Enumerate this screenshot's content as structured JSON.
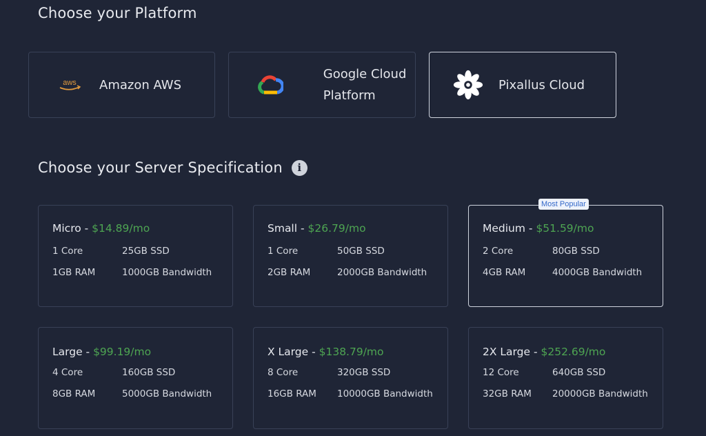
{
  "platform_section": {
    "title": "Choose your Platform",
    "options": [
      {
        "label": "Amazon AWS",
        "logo_text": "aws",
        "selected": false
      },
      {
        "label": "Google Cloud Platform",
        "selected": false
      },
      {
        "label": "Pixallus Cloud",
        "selected": true
      }
    ]
  },
  "spec_section": {
    "title": "Choose your Server Specification",
    "info_icon": "i",
    "badge": "Most Popular",
    "plans": [
      {
        "name": "Micro",
        "sep": " - ",
        "price": "$14.89/mo",
        "cores": "1 Core",
        "ssd": "25GB SSD",
        "ram": "1GB RAM",
        "bandwidth": "1000GB Bandwidth",
        "selected": false
      },
      {
        "name": "Small",
        "sep": " - ",
        "price": "$26.79/mo",
        "cores": "1 Core",
        "ssd": "50GB SSD",
        "ram": "2GB RAM",
        "bandwidth": "2000GB Bandwidth",
        "selected": false
      },
      {
        "name": "Medium",
        "sep": " - ",
        "price": "$51.59/mo",
        "cores": "2 Core",
        "ssd": "80GB SSD",
        "ram": "4GB RAM",
        "bandwidth": "4000GB Bandwidth",
        "selected": true
      },
      {
        "name": "Large",
        "sep": " - ",
        "price": "$99.19/mo",
        "cores": "4 Core",
        "ssd": "160GB SSD",
        "ram": "8GB RAM",
        "bandwidth": "5000GB Bandwidth",
        "selected": false
      },
      {
        "name": "X Large",
        "sep": " - ",
        "price": "$138.79/mo",
        "cores": "8 Core",
        "ssd": "320GB SSD",
        "ram": "16GB RAM",
        "bandwidth": "10000GB Bandwidth",
        "selected": false
      },
      {
        "name": "2X Large",
        "sep": " - ",
        "price": "$252.69/mo",
        "cores": "12 Core",
        "ssd": "640GB SSD",
        "ram": "32GB RAM",
        "bandwidth": "20000GB Bandwidth",
        "selected": false
      }
    ]
  },
  "colors": {
    "background": "#1f2536",
    "card_border": "#394157",
    "selected_border": "#cfd4de",
    "price_green": "#4ea552",
    "badge_text": "#3569c9"
  }
}
